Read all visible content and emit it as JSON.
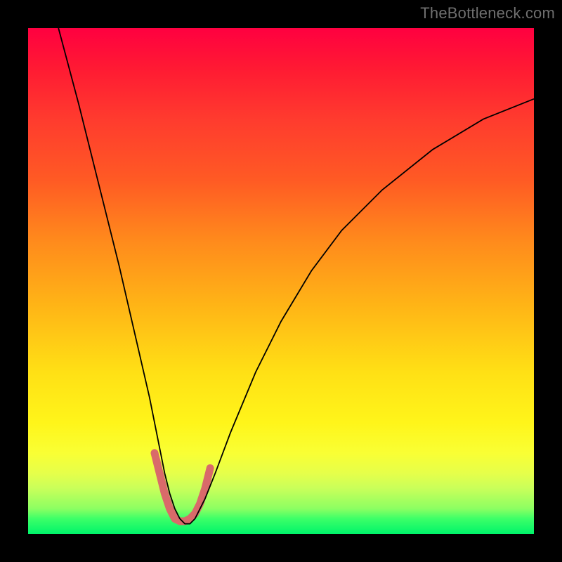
{
  "watermark": "TheBottleneck.com",
  "chart_data": {
    "type": "line",
    "title": "",
    "xlabel": "",
    "ylabel": "",
    "xlim": [
      0,
      100
    ],
    "ylim": [
      0,
      100
    ],
    "grid": false,
    "legend": false,
    "background_gradient": {
      "direction": "vertical",
      "stops": [
        {
          "pos": 0,
          "color": "#ff0040"
        },
        {
          "pos": 18,
          "color": "#ff3b2e"
        },
        {
          "pos": 42,
          "color": "#ff8a1c"
        },
        {
          "pos": 68,
          "color": "#ffe015"
        },
        {
          "pos": 88,
          "color": "#e6ff4a"
        },
        {
          "pos": 100,
          "color": "#00f46a"
        }
      ]
    },
    "series": [
      {
        "name": "main-curve",
        "color": "#000000",
        "stroke_width": 1.8,
        "x": [
          6,
          10,
          14,
          18,
          21,
          24,
          26,
          27,
          28,
          29,
          30,
          31,
          32,
          33,
          34,
          35,
          37,
          40,
          45,
          50,
          56,
          62,
          70,
          80,
          90,
          100
        ],
        "values": [
          100,
          85,
          69,
          53,
          40,
          27,
          17,
          12,
          8,
          5,
          3,
          2,
          2,
          3,
          5,
          7,
          12,
          20,
          32,
          42,
          52,
          60,
          68,
          76,
          82,
          86
        ]
      },
      {
        "name": "bottom-highlight",
        "color": "#d96a6a",
        "stroke_width": 11,
        "linecap": "round",
        "x": [
          25,
          26,
          27,
          28,
          29,
          30,
          31,
          32,
          33,
          34,
          35,
          36
        ],
        "values": [
          16,
          12,
          8,
          5,
          3,
          2.5,
          2.5,
          3,
          4,
          6,
          9,
          13
        ]
      }
    ]
  }
}
